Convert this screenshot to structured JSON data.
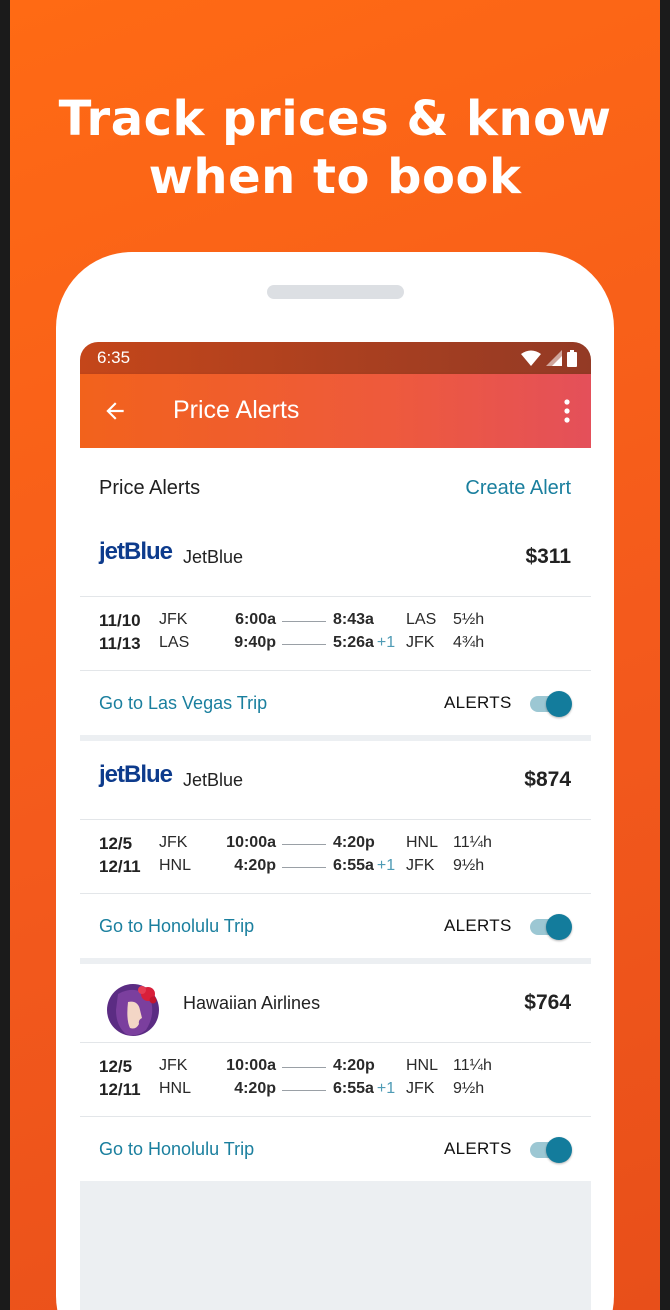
{
  "promo": {
    "headline": "Track prices & know when to book",
    "background_color": "#f45a1c"
  },
  "status_bar": {
    "time": "6:35",
    "icons": [
      "wifi-icon",
      "signal-icon",
      "battery-icon"
    ]
  },
  "app_bar": {
    "title": "Price Alerts",
    "back_icon": "arrow-left-icon",
    "menu_icon": "more-vert-icon"
  },
  "section": {
    "title": "Price Alerts",
    "action": "Create Alert"
  },
  "alerts": [
    {
      "airline": "JetBlue",
      "logo_text": "jetBlue",
      "price": "$311",
      "legs": [
        {
          "date": "11/10",
          "from": "JFK",
          "depart": "6:00a",
          "arrive": "8:43a",
          "plus_day": "",
          "to": "LAS",
          "duration": "5½h"
        },
        {
          "date": "11/13",
          "from": "LAS",
          "depart": "9:40p",
          "arrive": "5:26a",
          "plus_day": "+1",
          "to": "JFK",
          "duration": "4¾h"
        }
      ],
      "trip_link": "Go to Las Vegas Trip",
      "alerts_label": "ALERTS",
      "alerts_on": true
    },
    {
      "airline": "JetBlue",
      "logo_text": "jetBlue",
      "price": "$874",
      "legs": [
        {
          "date": "12/5",
          "from": "JFK",
          "depart": "10:00a",
          "arrive": "4:20p",
          "plus_day": "",
          "to": "HNL",
          "duration": "11¼h"
        },
        {
          "date": "12/11",
          "from": "HNL",
          "depart": "4:20p",
          "arrive": "6:55a",
          "plus_day": "+1",
          "to": "JFK",
          "duration": "9½h"
        }
      ],
      "trip_link": "Go to Honolulu Trip",
      "alerts_label": "ALERTS",
      "alerts_on": true
    },
    {
      "airline": "Hawaiian Airlines",
      "logo_text": "",
      "price": "$764",
      "legs": [
        {
          "date": "12/5",
          "from": "JFK",
          "depart": "10:00a",
          "arrive": "4:20p",
          "plus_day": "",
          "to": "HNL",
          "duration": "11¼h"
        },
        {
          "date": "12/11",
          "from": "HNL",
          "depart": "4:20p",
          "arrive": "6:55a",
          "plus_day": "+1",
          "to": "JFK",
          "duration": "9½h"
        }
      ],
      "trip_link": "Go to Honolulu Trip",
      "alerts_label": "ALERTS",
      "alerts_on": true
    }
  ],
  "colors": {
    "accent": "#1a7f9e",
    "toggle_on": "#137c9c",
    "app_bar": "#f2621c"
  }
}
